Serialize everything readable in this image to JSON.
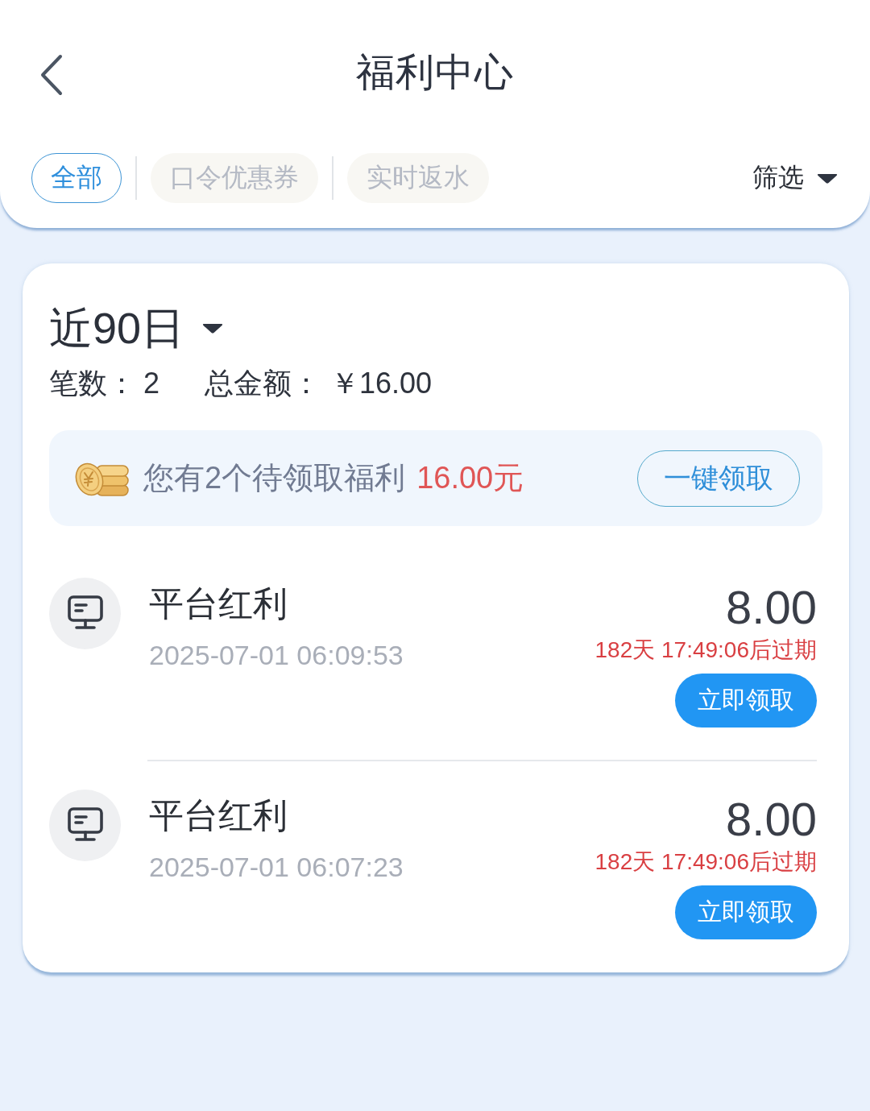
{
  "header": {
    "title": "福利中心"
  },
  "tabs": [
    {
      "label": "全部",
      "selected": true
    },
    {
      "label": "口令优惠券",
      "selected": false
    },
    {
      "label": "实时返水",
      "selected": false
    }
  ],
  "filter": {
    "label": "筛选"
  },
  "summary": {
    "period": "近90日",
    "count_label": "笔数：",
    "count": "2",
    "total_label": "总金额：",
    "total": "￥16.00"
  },
  "pending": {
    "message": "您有2个待领取福利",
    "amount": "16.00元",
    "button": "一键领取"
  },
  "items": [
    {
      "title": "平台红利",
      "time": "2025-07-01 06:09:53",
      "amount": "8.00",
      "expiry": "182天 17:49:06后过期",
      "button": "立即领取"
    },
    {
      "title": "平台红利",
      "time": "2025-07-01 06:07:23",
      "amount": "8.00",
      "expiry": "182天 17:49:06后过期",
      "button": "立即领取"
    }
  ]
}
